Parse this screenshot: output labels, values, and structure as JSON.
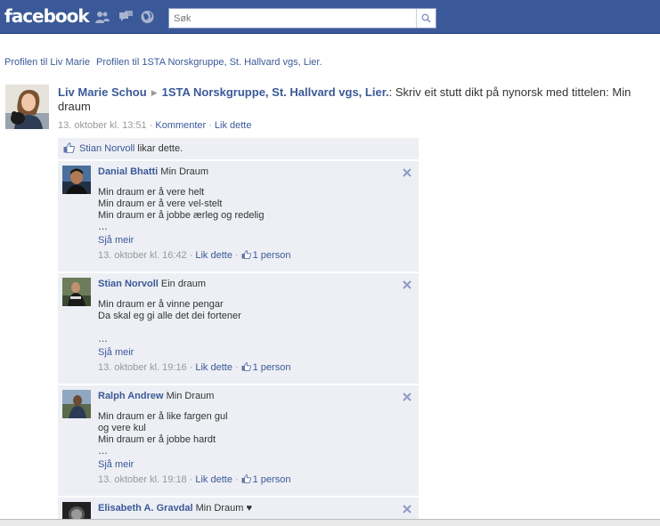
{
  "header": {
    "logo": "facebook",
    "search_placeholder": "Søk"
  },
  "breadcrumb": {
    "item1": "Profilen til Liv Marie",
    "item2": "Profilen til 1STA Norskgruppe, St. Hallvard vgs, Lier."
  },
  "story": {
    "actor": "Liv Marie Schou",
    "target": "1STA Norskgruppe, St. Hallvard vgs, Lier.",
    "text": ": Skriv eit stutt dikt på nynorsk med tittelen: Min draum",
    "timestamp": "13. oktober kl. 13:51",
    "comment_label": "Kommenter",
    "like_label": "Lik dette"
  },
  "likes": {
    "liker": "Stian Norvoll",
    "suffix": " likar dette."
  },
  "comments": [
    {
      "name": "Danial Bhatti",
      "title": "Min Draum",
      "body": "Min draum er å vere helt\nMin draum er å vere vel-stelt\nMin draum er å jobbe ærleg og redelig\n…",
      "more": "Sjå meir",
      "timestamp": "13. oktober kl. 16:42",
      "like_label": "Lik dette",
      "like_count": "1 person"
    },
    {
      "name": "Stian Norvoll",
      "title": "Ein draum",
      "body": "Min draum er å vinne pengar\nDa skal eg gi alle det dei fortener\n\n…",
      "more": "Sjå meir",
      "timestamp": "13. oktober kl. 19:16",
      "like_label": "Lik dette",
      "like_count": "1 person"
    },
    {
      "name": "Ralph Andrew",
      "title": "Min Draum",
      "body": "Min draum er å like fargen gul\nog vere kul\nMin draum er å jobbe hardt\n…",
      "more": "Sjå meir",
      "timestamp": "13. oktober kl. 19:18",
      "like_label": "Lik dette",
      "like_count": "1 person"
    },
    {
      "name": "Elisabeth A. Gravdal",
      "title": "Min Draum ♥"
    }
  ],
  "colors": {
    "brand": "#3b5998",
    "ufi_background": "#edeff4"
  }
}
